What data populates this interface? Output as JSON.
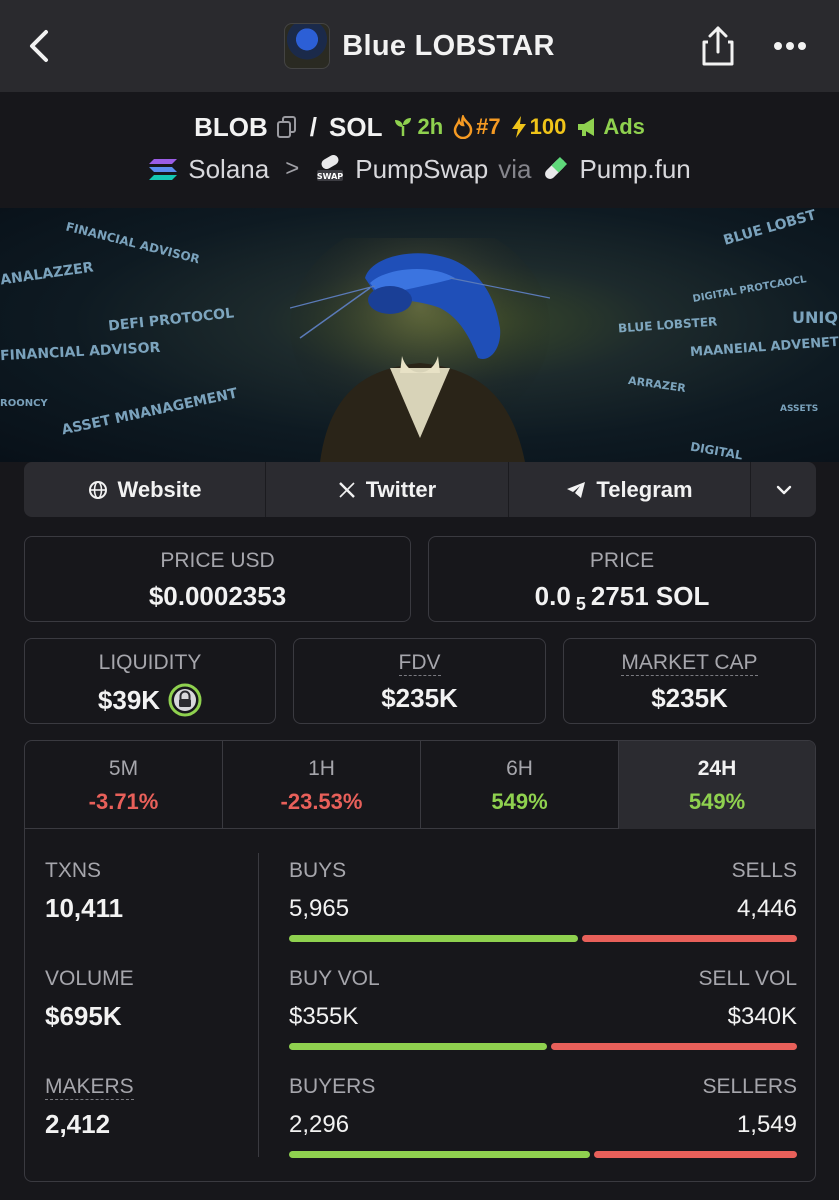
{
  "header": {
    "title": "Blue LOBSTAR"
  },
  "pair": {
    "base": "BLOB",
    "quote": "SOL",
    "age": "2h",
    "rank": "#7",
    "boost": "100",
    "ads": "Ads",
    "chain": "Solana",
    "dex": "PumpSwap",
    "via": "via",
    "launchpad": "Pump.fun",
    "swap_tag": "SWAP"
  },
  "banner": {
    "texts": [
      "FINANCIAL ADVISOR",
      "ANALAZZER",
      "DEFI PROTOCOL",
      "FINANCIAL ADVISOR",
      "ASSET MNANAGEMENT",
      "DIGITAL PROTCAOCL",
      "BLUE LOBSTER",
      "MAANEIAL ADVENET",
      "ARRAZER",
      "UNIQ",
      "BLUE LOBST",
      "DIGITAL",
      "ROONCY",
      "ASSETS"
    ]
  },
  "links": {
    "website": "Website",
    "twitter": "Twitter",
    "telegram": "Telegram"
  },
  "stats": {
    "price_usd_label": "PRICE USD",
    "price_usd": "$0.0002353",
    "price_label": "PRICE",
    "price_prefix": "0.0",
    "price_sub": "5",
    "price_suffix": "2751 SOL",
    "liquidity_label": "LIQUIDITY",
    "liquidity": "$39K",
    "fdv_label": "FDV",
    "fdv": "$235K",
    "mcap_label": "MARKET CAP",
    "mcap": "$235K"
  },
  "timeframes": [
    {
      "label": "5M",
      "change": "-3.71%"
    },
    {
      "label": "1H",
      "change": "-23.53%"
    },
    {
      "label": "6H",
      "change": "549%"
    },
    {
      "label": "24H",
      "change": "549%"
    }
  ],
  "activity": {
    "txns_label": "TXNS",
    "txns": "10,411",
    "volume_label": "VOLUME",
    "volume": "$695K",
    "makers_label": "MAKERS",
    "makers": "2,412",
    "buys_label": "BUYS",
    "buys": "5,965",
    "sells_label": "SELLS",
    "sells": "4,446",
    "buys_fraction": 0.573,
    "buyvol_label": "BUY VOL",
    "buyvol": "$355K",
    "sellvol_label": "SELL VOL",
    "sellvol": "$340K",
    "buyvol_fraction": 0.511,
    "buyers_label": "BUYERS",
    "buyers": "2,296",
    "sellers_label": "SELLERS",
    "sellers": "1,549",
    "buyers_fraction": 0.597
  },
  "colors": {
    "positive": "#8fd14f",
    "negative": "#e8605a",
    "background": "#17171b",
    "surface": "#2b2b30"
  }
}
